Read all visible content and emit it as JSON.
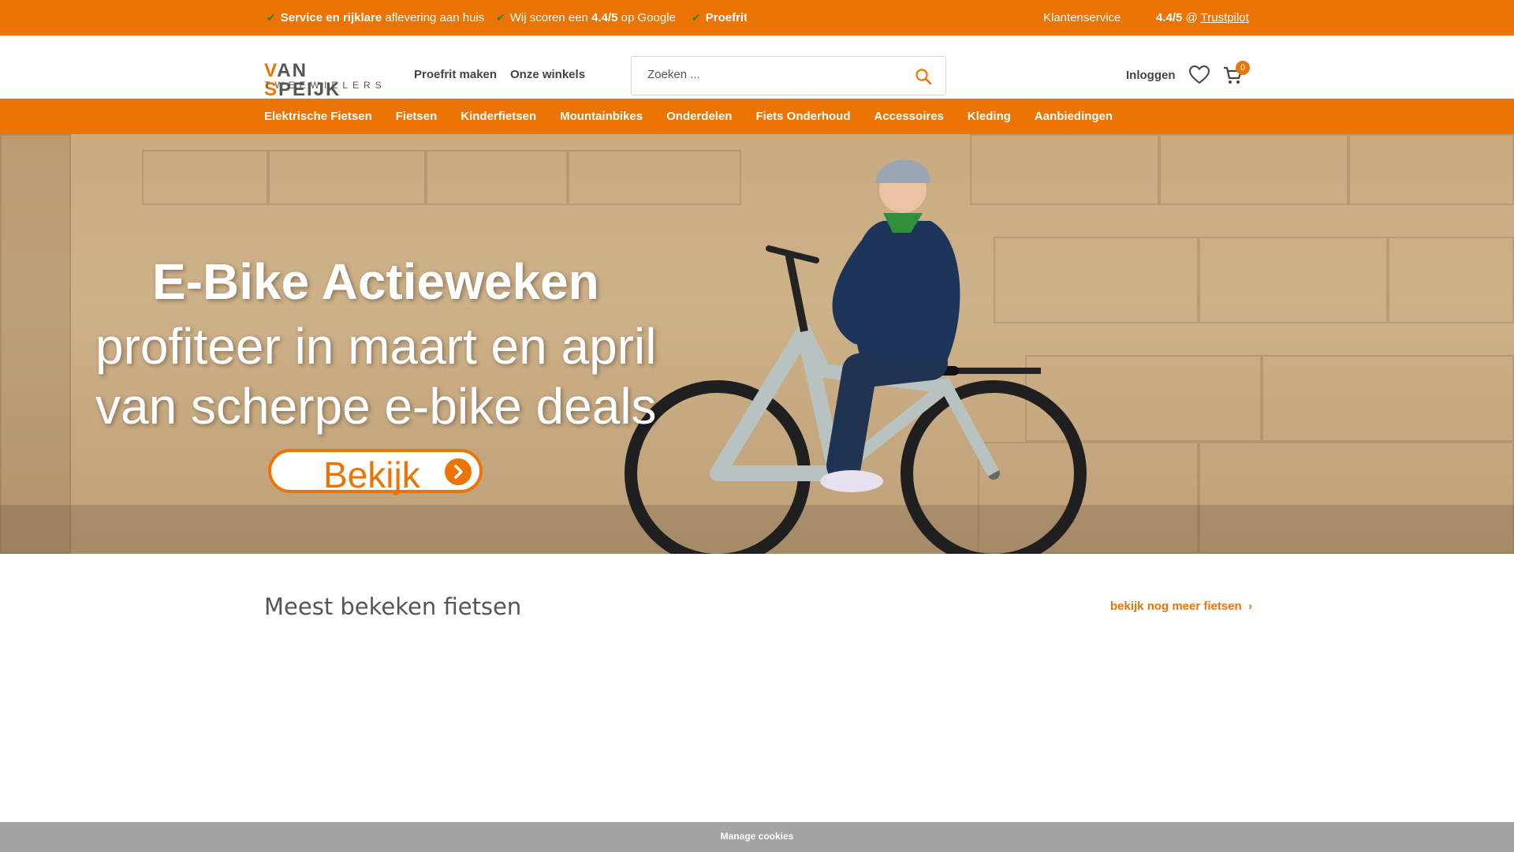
{
  "topbar": {
    "usp1_bold": "Service en rijklare",
    "usp1_rest": "aflevering aan huis",
    "usp2_pre": "Wij scoren een",
    "usp2_bold": "4.4/5",
    "usp2_post": "op Google",
    "usp3_bold": "Proefrit",
    "customer_service": "Klantenservice",
    "rating": "4.4/5",
    "at": "@",
    "trustpilot": "Trustpilot"
  },
  "header": {
    "logo_line1_first": "V",
    "logo_line1_mid": "AN ",
    "logo_line1_s": "S",
    "logo_line1_end": "PEIJK",
    "logo_line2": "TWEEWIELERS",
    "link_testride": "Proefrit maken",
    "link_stores": "Onze winkels",
    "search_placeholder": "Zoeken ...",
    "login": "Inloggen",
    "cart_count": "0"
  },
  "nav": {
    "items": [
      "Elektrische Fietsen",
      "Fietsen",
      "Kinderfietsen",
      "Mountainbikes",
      "Onderdelen",
      "Fiets Onderhoud",
      "Accessoires",
      "Kleding",
      "Aanbiedingen"
    ]
  },
  "hero": {
    "title": "E-Bike Actieweken",
    "subtitle_line1": "profiteer in maart en april",
    "subtitle_line2": "van scherpe e-bike deals",
    "button": "Bekijk"
  },
  "section": {
    "title": "Meest bekeken fietsen",
    "link": "bekijk nog meer fietsen"
  },
  "cookie": {
    "label": "Manage cookies"
  },
  "colors": {
    "accent": "#ec7404",
    "check": "#2e7d32",
    "cookie_bar": "#a3a3a3"
  }
}
